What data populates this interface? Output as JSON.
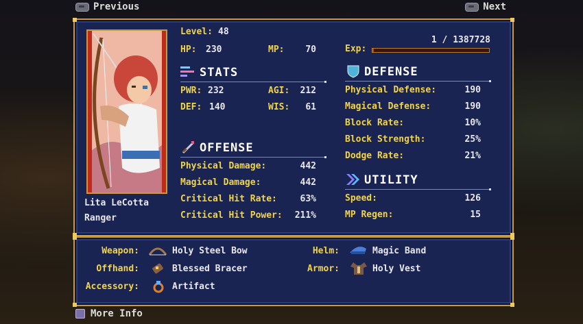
{
  "nav": {
    "previous": "Previous",
    "next": "Next",
    "more_info": "More Info"
  },
  "character": {
    "name": "Lita LeCotta",
    "class": "Ranger"
  },
  "summary": {
    "level_label": "Level:",
    "level": "48",
    "hp_label": "HP:",
    "hp": "230",
    "mp_label": "MP:",
    "mp": "70",
    "exp_label": "Exp:",
    "exp_value": "1 / 1387728",
    "exp_fraction": 7e-07
  },
  "stats": {
    "title": "STATS",
    "pwr_label": "PWR:",
    "pwr": "232",
    "agi_label": "AGI:",
    "agi": "212",
    "def_label": "DEF:",
    "def": "140",
    "wis_label": "WIS:",
    "wis": "61"
  },
  "offense": {
    "title": "OFFENSE",
    "rows": [
      {
        "label": "Physical Damage:",
        "value": "442"
      },
      {
        "label": "Magical Damage:",
        "value": "442"
      },
      {
        "label": "Critical Hit Rate:",
        "value": "63%"
      },
      {
        "label": "Critical Hit Power:",
        "value": "211%"
      }
    ]
  },
  "defense": {
    "title": "DEFENSE",
    "rows": [
      {
        "label": "Physical Defense:",
        "value": "190"
      },
      {
        "label": "Magical Defense:",
        "value": "190"
      },
      {
        "label": "Block Rate:",
        "value": "10%"
      },
      {
        "label": "Block Strength:",
        "value": "25%"
      },
      {
        "label": "Dodge Rate:",
        "value": "21%"
      }
    ]
  },
  "utility": {
    "title": "UTILITY",
    "rows": [
      {
        "label": "Speed:",
        "value": "126"
      },
      {
        "label": "MP Regen:",
        "value": "15"
      }
    ]
  },
  "equipment": {
    "weapon_label": "Weapon:",
    "weapon": "Holy Steel Bow",
    "offhand_label": "Offhand:",
    "offhand": "Blessed Bracer",
    "accessory_label": "Accessory:",
    "accessory": "Artifact",
    "helm_label": "Helm:",
    "helm": "Magic Band",
    "armor_label": "Armor:",
    "armor": "Holy Vest"
  },
  "colors": {
    "accent_gold": "#f2d44a",
    "panel_blue": "#1a2452",
    "border_gold": "#c79a3a"
  }
}
